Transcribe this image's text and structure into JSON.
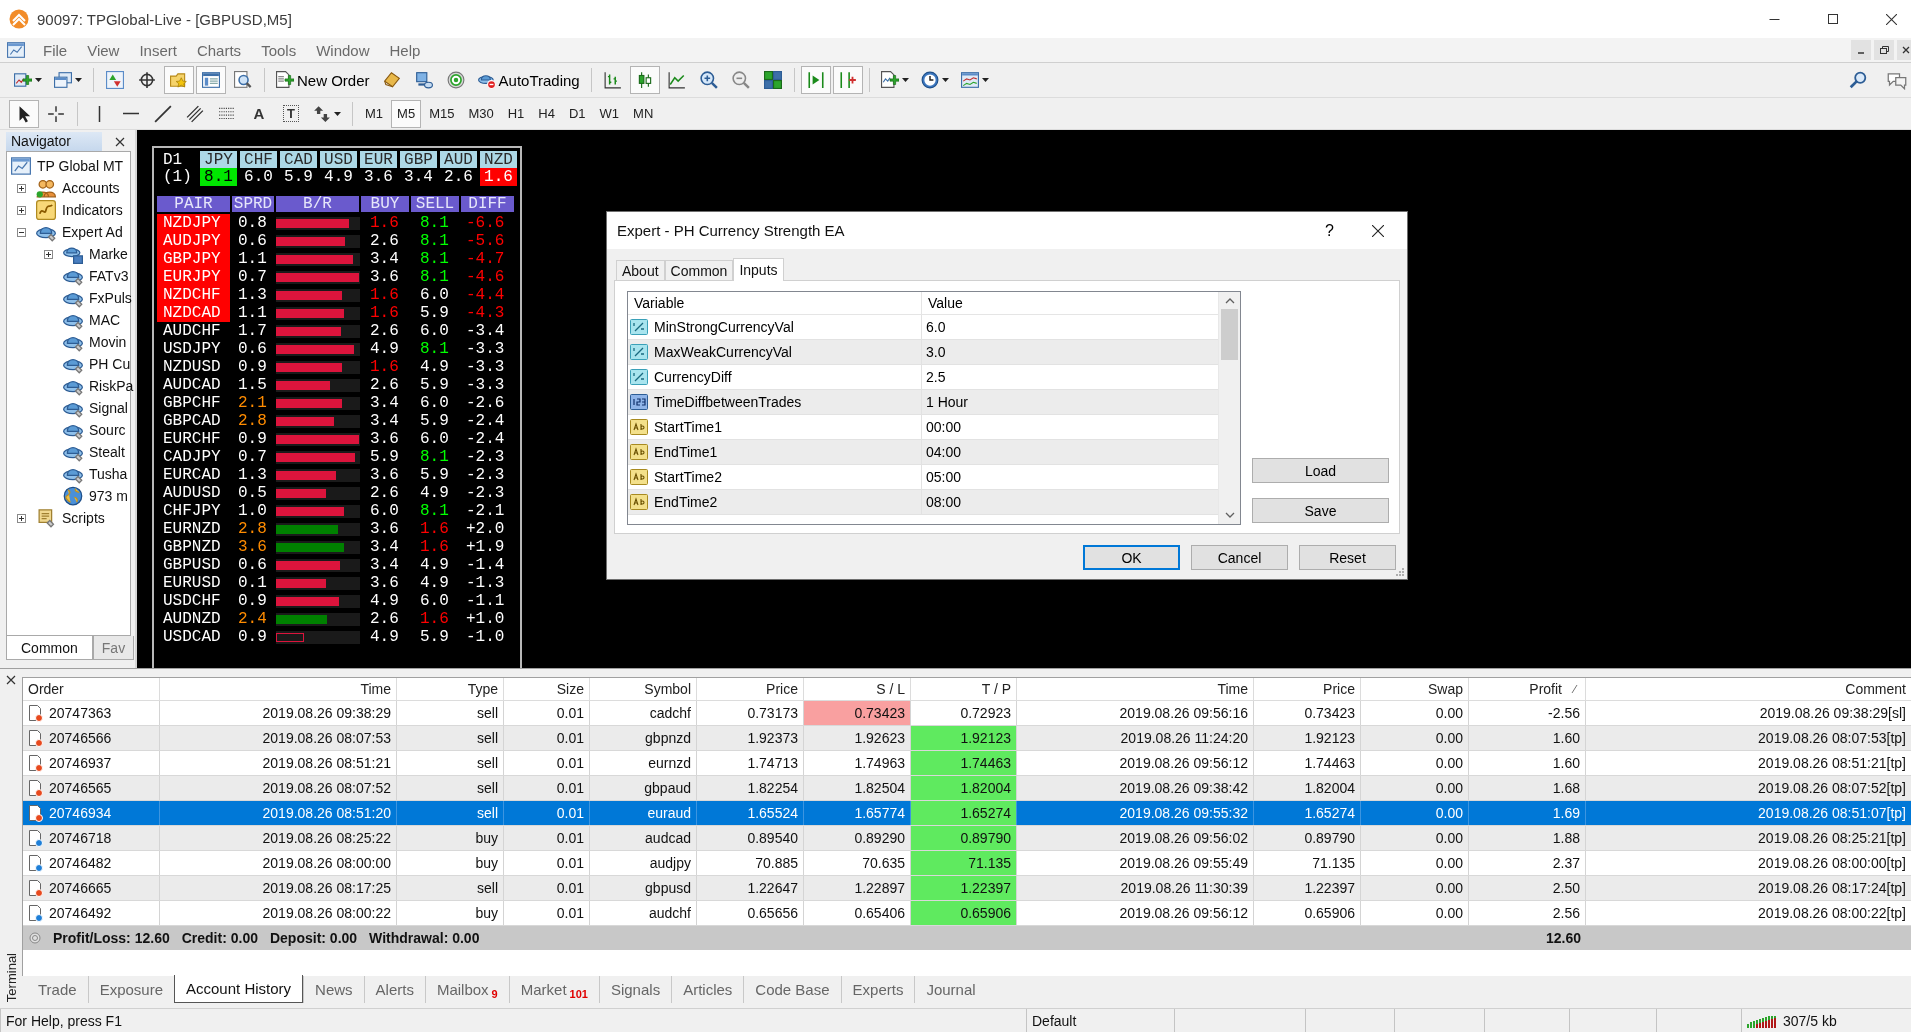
{
  "window": {
    "title": "90097: TPGlobal-Live - [GBPUSD,M5]"
  },
  "menu": [
    "File",
    "View",
    "Insert",
    "Charts",
    "Tools",
    "Window",
    "Help"
  ],
  "toolbar": [
    {
      "kind": "new-chart",
      "pressed": false,
      "dropdown": true
    },
    {
      "kind": "profiles",
      "pressed": false,
      "dropdown": true
    },
    {
      "kind": "separator"
    },
    {
      "kind": "market-watch",
      "pressed": false
    },
    {
      "kind": "data-window",
      "pressed": false
    },
    {
      "kind": "navigator",
      "pressed": true
    },
    {
      "kind": "terminal",
      "pressed": true
    },
    {
      "kind": "tester",
      "pressed": false
    },
    {
      "kind": "separator"
    },
    {
      "kind": "new-order",
      "label": "New Order",
      "pressed": false
    },
    {
      "kind": "editor",
      "pressed": false
    },
    {
      "kind": "monitor",
      "pressed": false
    },
    {
      "kind": "signal",
      "pressed": false
    },
    {
      "kind": "autotrading",
      "label": "AutoTrading",
      "pressed": false
    },
    {
      "kind": "separator"
    },
    {
      "kind": "bar-chart",
      "pressed": false
    },
    {
      "kind": "candles",
      "pressed": true
    },
    {
      "kind": "line-chart",
      "pressed": false
    },
    {
      "kind": "zoom-in",
      "pressed": false
    },
    {
      "kind": "zoom-out",
      "pressed": false
    },
    {
      "kind": "tile",
      "pressed": false
    },
    {
      "kind": "separator"
    },
    {
      "kind": "auto-scroll",
      "pressed": true
    },
    {
      "kind": "chart-shift",
      "pressed": true
    },
    {
      "kind": "separator"
    },
    {
      "kind": "indicators",
      "pressed": false,
      "dropdown": true
    },
    {
      "kind": "periods",
      "pressed": false,
      "dropdown": true
    },
    {
      "kind": "templates",
      "pressed": false,
      "dropdown": true
    }
  ],
  "drawing_toolbar": [
    {
      "kind": "cursor",
      "pressed": true
    },
    {
      "kind": "crosshair",
      "pressed": false
    },
    {
      "kind": "separator"
    },
    {
      "kind": "vertical-line",
      "pressed": false
    },
    {
      "kind": "horizontal-line",
      "pressed": false
    },
    {
      "kind": "trendline",
      "pressed": false
    },
    {
      "kind": "channel",
      "pressed": false
    },
    {
      "kind": "fibonacci",
      "pressed": false
    },
    {
      "kind": "text",
      "label": "A",
      "pressed": false
    },
    {
      "kind": "text-label",
      "label": "T",
      "pressed": false
    },
    {
      "kind": "arrows",
      "pressed": false,
      "dropdown": true
    },
    {
      "kind": "separator"
    }
  ],
  "timeframes": [
    {
      "label": "M1",
      "selected": false
    },
    {
      "label": "M5",
      "selected": true
    },
    {
      "label": "M15",
      "selected": false
    },
    {
      "label": "M30",
      "selected": false
    },
    {
      "label": "H1",
      "selected": false
    },
    {
      "label": "H4",
      "selected": false
    },
    {
      "label": "D1",
      "selected": false
    },
    {
      "label": "W1",
      "selected": false
    },
    {
      "label": "MN",
      "selected": false
    }
  ],
  "navigator": {
    "title": "Navigator",
    "tree": [
      {
        "label": "TP Global MT",
        "kind": "terminal",
        "children": [
          {
            "label": "Accounts",
            "kind": "accounts",
            "expanded": false
          },
          {
            "label": "Indicators",
            "kind": "indicators",
            "expanded": false
          },
          {
            "label": "Expert Ad",
            "kind": "experts",
            "expanded": true,
            "children": [
              {
                "label": "Marke",
                "kind": "market",
                "expanded": false
              },
              {
                "label": "FATv3",
                "kind": "expert"
              },
              {
                "label": "FxPuls",
                "kind": "expert"
              },
              {
                "label": "MAC",
                "kind": "expert"
              },
              {
                "label": "Movin",
                "kind": "expert"
              },
              {
                "label": "PH Cu",
                "kind": "expert"
              },
              {
                "label": "RiskPa",
                "kind": "expert"
              },
              {
                "label": "Signal",
                "kind": "expert"
              },
              {
                "label": "Sourc",
                "kind": "expert"
              },
              {
                "label": "Stealt",
                "kind": "expert"
              },
              {
                "label": "Tusha",
                "kind": "expert"
              },
              {
                "label": "973 m",
                "kind": "globe"
              }
            ]
          },
          {
            "label": "Scripts",
            "kind": "scripts",
            "expanded": false
          }
        ]
      }
    ],
    "tabs": [
      {
        "label": "Common",
        "selected": true
      },
      {
        "label": "Fav",
        "selected": false
      }
    ]
  },
  "strength_panel": {
    "timeframe": "D1",
    "shift": "(1)",
    "currencies": [
      {
        "code": "JPY",
        "value": "8.1",
        "strongest": true,
        "weakest": false
      },
      {
        "code": "CHF",
        "value": "6.0",
        "strongest": false,
        "weakest": false
      },
      {
        "code": "CAD",
        "value": "5.9",
        "strongest": false,
        "weakest": false
      },
      {
        "code": "USD",
        "value": "4.9",
        "strongest": false,
        "weakest": false
      },
      {
        "code": "EUR",
        "value": "3.6",
        "strongest": false,
        "weakest": false
      },
      {
        "code": "GBP",
        "value": "3.4",
        "strongest": false,
        "weakest": false
      },
      {
        "code": "AUD",
        "value": "2.6",
        "strongest": false,
        "weakest": false
      },
      {
        "code": "NZD",
        "value": "1.6",
        "strongest": false,
        "weakest": true
      }
    ],
    "columns": [
      "PAIR",
      "SPRD",
      "B/R",
      "BUY",
      "SELL",
      "DIFF"
    ],
    "rows": [
      {
        "pair": "NZDJPY",
        "alert": true,
        "spread": {
          "text": "0.8",
          "color": "#ffffff"
        },
        "bar": {
          "level": 0.87,
          "color": "#dc143c",
          "filled": true
        },
        "buy": {
          "text": "1.6",
          "color": "#ff0000"
        },
        "sell": {
          "text": "8.1",
          "color": "#00ff00"
        },
        "diff": {
          "text": "-6.6",
          "color": "#ff0000"
        }
      },
      {
        "pair": "AUDJPY",
        "alert": true,
        "spread": {
          "text": "0.6",
          "color": "#ffffff"
        },
        "bar": {
          "level": 0.82,
          "color": "#dc143c",
          "filled": true
        },
        "buy": {
          "text": "2.6",
          "color": "#ffffff"
        },
        "sell": {
          "text": "8.1",
          "color": "#00ff00"
        },
        "diff": {
          "text": "-5.6",
          "color": "#ff0000"
        }
      },
      {
        "pair": "GBPJPY",
        "alert": true,
        "spread": {
          "text": "1.1",
          "color": "#ffffff"
        },
        "bar": {
          "level": 0.92,
          "color": "#dc143c",
          "filled": true
        },
        "buy": {
          "text": "3.4",
          "color": "#ffffff"
        },
        "sell": {
          "text": "8.1",
          "color": "#00ff00"
        },
        "diff": {
          "text": "-4.7",
          "color": "#ff0000"
        }
      },
      {
        "pair": "EURJPY",
        "alert": true,
        "spread": {
          "text": "0.7",
          "color": "#ffffff"
        },
        "bar": {
          "level": 0.99,
          "color": "#dc143c",
          "filled": true
        },
        "buy": {
          "text": "3.6",
          "color": "#ffffff"
        },
        "sell": {
          "text": "8.1",
          "color": "#00ff00"
        },
        "diff": {
          "text": "-4.6",
          "color": "#ff0000"
        }
      },
      {
        "pair": "NZDCHF",
        "alert": true,
        "spread": {
          "text": "1.3",
          "color": "#ffffff"
        },
        "bar": {
          "level": 0.78,
          "color": "#dc143c",
          "filled": true
        },
        "buy": {
          "text": "1.6",
          "color": "#ff0000"
        },
        "sell": {
          "text": "6.0",
          "color": "#ffffff"
        },
        "diff": {
          "text": "-4.4",
          "color": "#ff0000"
        }
      },
      {
        "pair": "NZDCAD",
        "alert": true,
        "spread": {
          "text": "1.1",
          "color": "#ffffff"
        },
        "bar": {
          "level": 0.81,
          "color": "#dc143c",
          "filled": true
        },
        "buy": {
          "text": "1.6",
          "color": "#ff0000"
        },
        "sell": {
          "text": "5.9",
          "color": "#ffffff"
        },
        "diff": {
          "text": "-4.3",
          "color": "#ff0000"
        }
      },
      {
        "pair": "AUDCHF",
        "alert": false,
        "spread": {
          "text": "1.7",
          "color": "#ffffff"
        },
        "bar": {
          "level": 0.77,
          "color": "#dc143c",
          "filled": true
        },
        "buy": {
          "text": "2.6",
          "color": "#ffffff"
        },
        "sell": {
          "text": "6.0",
          "color": "#ffffff"
        },
        "diff": {
          "text": "-3.4",
          "color": "#ffffff"
        }
      },
      {
        "pair": "USDJPY",
        "alert": false,
        "spread": {
          "text": "0.6",
          "color": "#ffffff"
        },
        "bar": {
          "level": 0.93,
          "color": "#dc143c",
          "filled": true
        },
        "buy": {
          "text": "4.9",
          "color": "#ffffff"
        },
        "sell": {
          "text": "8.1",
          "color": "#00ff00"
        },
        "diff": {
          "text": "-3.3",
          "color": "#ffffff"
        }
      },
      {
        "pair": "NZDUSD",
        "alert": false,
        "spread": {
          "text": "0.9",
          "color": "#ffffff"
        },
        "bar": {
          "level": 0.78,
          "color": "#dc143c",
          "filled": true
        },
        "buy": {
          "text": "1.6",
          "color": "#ff0000"
        },
        "sell": {
          "text": "4.9",
          "color": "#ffffff"
        },
        "diff": {
          "text": "-3.3",
          "color": "#ffffff"
        }
      },
      {
        "pair": "AUDCAD",
        "alert": false,
        "spread": {
          "text": "1.5",
          "color": "#ffffff"
        },
        "bar": {
          "level": 0.64,
          "color": "#dc143c",
          "filled": true
        },
        "buy": {
          "text": "2.6",
          "color": "#ffffff"
        },
        "sell": {
          "text": "5.9",
          "color": "#ffffff"
        },
        "diff": {
          "text": "-3.3",
          "color": "#ffffff"
        }
      },
      {
        "pair": "GBPCHF",
        "alert": false,
        "spread": {
          "text": "2.1",
          "color": "#ff8c00"
        },
        "bar": {
          "level": 0.79,
          "color": "#dc143c",
          "filled": true
        },
        "buy": {
          "text": "3.4",
          "color": "#ffffff"
        },
        "sell": {
          "text": "6.0",
          "color": "#ffffff"
        },
        "diff": {
          "text": "-2.6",
          "color": "#ffffff"
        }
      },
      {
        "pair": "GBPCAD",
        "alert": false,
        "spread": {
          "text": "2.8",
          "color": "#ff8c00"
        },
        "bar": {
          "level": 0.69,
          "color": "#dc143c",
          "filled": true
        },
        "buy": {
          "text": "3.4",
          "color": "#ffffff"
        },
        "sell": {
          "text": "5.9",
          "color": "#ffffff"
        },
        "diff": {
          "text": "-2.4",
          "color": "#ffffff"
        }
      },
      {
        "pair": "EURCHF",
        "alert": false,
        "spread": {
          "text": "0.9",
          "color": "#ffffff"
        },
        "bar": {
          "level": 0.99,
          "color": "#dc143c",
          "filled": true
        },
        "buy": {
          "text": "3.6",
          "color": "#ffffff"
        },
        "sell": {
          "text": "6.0",
          "color": "#ffffff"
        },
        "diff": {
          "text": "-2.4",
          "color": "#ffffff"
        }
      },
      {
        "pair": "CADJPY",
        "alert": false,
        "spread": {
          "text": "0.7",
          "color": "#ffffff"
        },
        "bar": {
          "level": 0.94,
          "color": "#dc143c",
          "filled": true
        },
        "buy": {
          "text": "5.9",
          "color": "#ffffff"
        },
        "sell": {
          "text": "8.1",
          "color": "#00ff00"
        },
        "diff": {
          "text": "-2.3",
          "color": "#ffffff"
        }
      },
      {
        "pair": "EURCAD",
        "alert": false,
        "spread": {
          "text": "1.3",
          "color": "#ffffff"
        },
        "bar": {
          "level": 0.71,
          "color": "#dc143c",
          "filled": true
        },
        "buy": {
          "text": "3.6",
          "color": "#ffffff"
        },
        "sell": {
          "text": "5.9",
          "color": "#ffffff"
        },
        "diff": {
          "text": "-2.3",
          "color": "#ffffff"
        }
      },
      {
        "pair": "AUDUSD",
        "alert": false,
        "spread": {
          "text": "0.5",
          "color": "#ffffff"
        },
        "bar": {
          "level": 0.59,
          "color": "#dc143c",
          "filled": true
        },
        "buy": {
          "text": "2.6",
          "color": "#ffffff"
        },
        "sell": {
          "text": "4.9",
          "color": "#ffffff"
        },
        "diff": {
          "text": "-2.3",
          "color": "#ffffff"
        }
      },
      {
        "pair": "CHFJPY",
        "alert": false,
        "spread": {
          "text": "1.0",
          "color": "#ffffff"
        },
        "bar": {
          "level": 0.81,
          "color": "#dc143c",
          "filled": true
        },
        "buy": {
          "text": "6.0",
          "color": "#ffffff"
        },
        "sell": {
          "text": "8.1",
          "color": "#00ff00"
        },
        "diff": {
          "text": "-2.1",
          "color": "#ffffff"
        }
      },
      {
        "pair": "EURNZD",
        "alert": false,
        "spread": {
          "text": "2.8",
          "color": "#ff8c00"
        },
        "bar": {
          "level": 0.74,
          "color": "#008000",
          "filled": true
        },
        "buy": {
          "text": "3.6",
          "color": "#ffffff"
        },
        "sell": {
          "text": "1.6",
          "color": "#ff0000"
        },
        "diff": {
          "text": "+2.0",
          "color": "#ffffff"
        }
      },
      {
        "pair": "GBPNZD",
        "alert": false,
        "spread": {
          "text": "3.6",
          "color": "#ff8c00"
        },
        "bar": {
          "level": 0.81,
          "color": "#008000",
          "filled": true
        },
        "buy": {
          "text": "3.4",
          "color": "#ffffff"
        },
        "sell": {
          "text": "1.6",
          "color": "#ff0000"
        },
        "diff": {
          "text": "+1.9",
          "color": "#ffffff"
        }
      },
      {
        "pair": "GBPUSD",
        "alert": false,
        "spread": {
          "text": "0.6",
          "color": "#ffffff"
        },
        "bar": {
          "level": 0.76,
          "color": "#dc143c",
          "filled": true
        },
        "buy": {
          "text": "3.4",
          "color": "#ffffff"
        },
        "sell": {
          "text": "4.9",
          "color": "#ffffff"
        },
        "diff": {
          "text": "-1.4",
          "color": "#ffffff"
        }
      },
      {
        "pair": "EURUSD",
        "alert": false,
        "spread": {
          "text": "0.1",
          "color": "#ffffff"
        },
        "bar": {
          "level": 0.59,
          "color": "#dc143c",
          "filled": true
        },
        "buy": {
          "text": "3.6",
          "color": "#ffffff"
        },
        "sell": {
          "text": "4.9",
          "color": "#ffffff"
        },
        "diff": {
          "text": "-1.3",
          "color": "#ffffff"
        }
      },
      {
        "pair": "USDCHF",
        "alert": false,
        "spread": {
          "text": "0.9",
          "color": "#ffffff"
        },
        "bar": {
          "level": 0.75,
          "color": "#dc143c",
          "filled": true
        },
        "buy": {
          "text": "4.9",
          "color": "#ffffff"
        },
        "sell": {
          "text": "6.0",
          "color": "#ffffff"
        },
        "diff": {
          "text": "-1.1",
          "color": "#ffffff"
        }
      },
      {
        "pair": "AUDNZD",
        "alert": false,
        "spread": {
          "text": "2.4",
          "color": "#ff8c00"
        },
        "bar": {
          "level": 0.61,
          "color": "#008000",
          "filled": true
        },
        "buy": {
          "text": "2.6",
          "color": "#ffffff"
        },
        "sell": {
          "text": "1.6",
          "color": "#ff0000"
        },
        "diff": {
          "text": "+1.0",
          "color": "#ffffff"
        }
      },
      {
        "pair": "USDCAD",
        "alert": false,
        "spread": {
          "text": "0.9",
          "color": "#ffffff"
        },
        "bar": {
          "level": 0.33,
          "color": "#dc143c",
          "filled": false
        },
        "buy": {
          "text": "4.9",
          "color": "#ffffff"
        },
        "sell": {
          "text": "5.9",
          "color": "#ffffff"
        },
        "diff": {
          "text": "-1.0",
          "color": "#ffffff"
        }
      }
    ]
  },
  "dialog": {
    "title": "Expert - PH Currency Strength EA",
    "help": "?",
    "tabs": [
      {
        "label": "About",
        "selected": false
      },
      {
        "label": "Common",
        "selected": false
      },
      {
        "label": "Inputs",
        "selected": true
      }
    ],
    "columns": [
      "Variable",
      "Value"
    ],
    "inputs": [
      {
        "kind": "double",
        "variable": "MinStrongCurrencyVal",
        "value": "6.0"
      },
      {
        "kind": "double",
        "variable": "MaxWeakCurrencyVal",
        "value": "3.0"
      },
      {
        "kind": "double",
        "variable": "CurrencyDiff",
        "value": "2.5"
      },
      {
        "kind": "integer",
        "variable": "TimeDiffbetweenTrades",
        "value": "1 Hour"
      },
      {
        "kind": "string",
        "variable": "StartTime1",
        "value": "00:00"
      },
      {
        "kind": "string",
        "variable": "EndTime1",
        "value": "04:00"
      },
      {
        "kind": "string",
        "variable": "StartTime2",
        "value": "05:00"
      },
      {
        "kind": "string",
        "variable": "EndTime2",
        "value": "08:00"
      }
    ],
    "side_buttons": [
      "Load",
      "Save"
    ],
    "buttons": [
      {
        "label": "OK",
        "default": true
      },
      {
        "label": "Cancel",
        "default": false
      },
      {
        "label": "Reset",
        "default": false
      }
    ]
  },
  "terminal": {
    "title": "Terminal",
    "columns": [
      {
        "label": "Order",
        "sorted": false
      },
      {
        "label": "Time",
        "sorted": false
      },
      {
        "label": "Type",
        "sorted": false
      },
      {
        "label": "Size",
        "sorted": false
      },
      {
        "label": "Symbol",
        "sorted": false
      },
      {
        "label": "Price",
        "sorted": false
      },
      {
        "label": "S / L",
        "sorted": false
      },
      {
        "label": "T / P",
        "sorted": false
      },
      {
        "label": "Time",
        "sorted": false
      },
      {
        "label": "Price",
        "sorted": false
      },
      {
        "label": "Swap",
        "sorted": false
      },
      {
        "label": "Profit",
        "sorted": true
      },
      {
        "label": "Comment",
        "sorted": false
      }
    ],
    "rows": [
      {
        "kind": "sell",
        "selected": false,
        "sl_hit": true,
        "tp_hit": false,
        "cells": [
          "20747363",
          "2019.08.26 09:38:29",
          "sell",
          "0.01",
          "cadchf",
          "0.73173",
          "0.73423",
          "0.72923",
          "2019.08.26 09:56:16",
          "0.73423",
          "0.00",
          "-2.56",
          "2019.08.26 09:38:29[sl]"
        ]
      },
      {
        "kind": "sell",
        "selected": false,
        "sl_hit": false,
        "tp_hit": true,
        "cells": [
          "20746566",
          "2019.08.26 08:07:53",
          "sell",
          "0.01",
          "gbpnzd",
          "1.92373",
          "1.92623",
          "1.92123",
          "2019.08.26 11:24:20",
          "1.92123",
          "0.00",
          "1.60",
          "2019.08.26 08:07:53[tp]"
        ]
      },
      {
        "kind": "sell",
        "selected": false,
        "sl_hit": false,
        "tp_hit": true,
        "cells": [
          "20746937",
          "2019.08.26 08:51:21",
          "sell",
          "0.01",
          "eurnzd",
          "1.74713",
          "1.74963",
          "1.74463",
          "2019.08.26 09:56:12",
          "1.74463",
          "0.00",
          "1.60",
          "2019.08.26 08:51:21[tp]"
        ]
      },
      {
        "kind": "sell",
        "selected": false,
        "sl_hit": false,
        "tp_hit": true,
        "cells": [
          "20746565",
          "2019.08.26 08:07:52",
          "sell",
          "0.01",
          "gbpaud",
          "1.82254",
          "1.82504",
          "1.82004",
          "2019.08.26 09:38:42",
          "1.82004",
          "0.00",
          "1.68",
          "2019.08.26 08:07:52[tp]"
        ]
      },
      {
        "kind": "sell",
        "selected": true,
        "sl_hit": false,
        "tp_hit": true,
        "cells": [
          "20746934",
          "2019.08.26 08:51:20",
          "sell",
          "0.01",
          "euraud",
          "1.65524",
          "1.65774",
          "1.65274",
          "2019.08.26 09:55:32",
          "1.65274",
          "0.00",
          "1.69",
          "2019.08.26 08:51:07[tp]"
        ]
      },
      {
        "kind": "buy",
        "selected": false,
        "sl_hit": false,
        "tp_hit": true,
        "cells": [
          "20746718",
          "2019.08.26 08:25:22",
          "buy",
          "0.01",
          "audcad",
          "0.89540",
          "0.89290",
          "0.89790",
          "2019.08.26 09:56:02",
          "0.89790",
          "0.00",
          "1.88",
          "2019.08.26 08:25:21[tp]"
        ]
      },
      {
        "kind": "buy",
        "selected": false,
        "sl_hit": false,
        "tp_hit": true,
        "cells": [
          "20746482",
          "2019.08.26 08:00:00",
          "buy",
          "0.01",
          "audjpy",
          "70.885",
          "70.635",
          "71.135",
          "2019.08.26 09:55:49",
          "71.135",
          "0.00",
          "2.37",
          "2019.08.26 08:00:00[tp]"
        ]
      },
      {
        "kind": "sell",
        "selected": false,
        "sl_hit": false,
        "tp_hit": true,
        "cells": [
          "20746665",
          "2019.08.26 08:17:25",
          "sell",
          "0.01",
          "gbpusd",
          "1.22647",
          "1.22897",
          "1.22397",
          "2019.08.26 11:30:39",
          "1.22397",
          "0.00",
          "2.50",
          "2019.08.26 08:17:24[tp]"
        ]
      },
      {
        "kind": "buy",
        "selected": false,
        "sl_hit": false,
        "tp_hit": true,
        "cells": [
          "20746492",
          "2019.08.26 08:00:22",
          "buy",
          "0.01",
          "audchf",
          "0.65656",
          "0.65406",
          "0.65906",
          "2019.08.26 09:56:12",
          "0.65906",
          "0.00",
          "2.56",
          "2019.08.26 08:00:22[tp]"
        ]
      }
    ],
    "summary": {
      "items": [
        "Profit/Loss: 12.60",
        "Credit: 0.00",
        "Deposit: 0.00",
        "Withdrawal: 0.00"
      ],
      "profit": "12.60"
    },
    "tabs": [
      {
        "label": "Trade",
        "selected": false
      },
      {
        "label": "Exposure",
        "selected": false
      },
      {
        "label": "Account History",
        "selected": true
      },
      {
        "label": "News",
        "selected": false
      },
      {
        "label": "Alerts",
        "selected": false
      },
      {
        "label": "Mailbox",
        "badge": "9",
        "selected": false
      },
      {
        "label": "Market",
        "badge": "101",
        "selected": false
      },
      {
        "label": "Signals",
        "selected": false
      },
      {
        "label": "Articles",
        "selected": false
      },
      {
        "label": "Code Base",
        "selected": false
      },
      {
        "label": "Experts",
        "selected": false
      },
      {
        "label": "Journal",
        "selected": false
      }
    ]
  },
  "status_bar": {
    "help": "For Help, press F1",
    "profile": "Default",
    "traffic": "307/5 kb"
  }
}
